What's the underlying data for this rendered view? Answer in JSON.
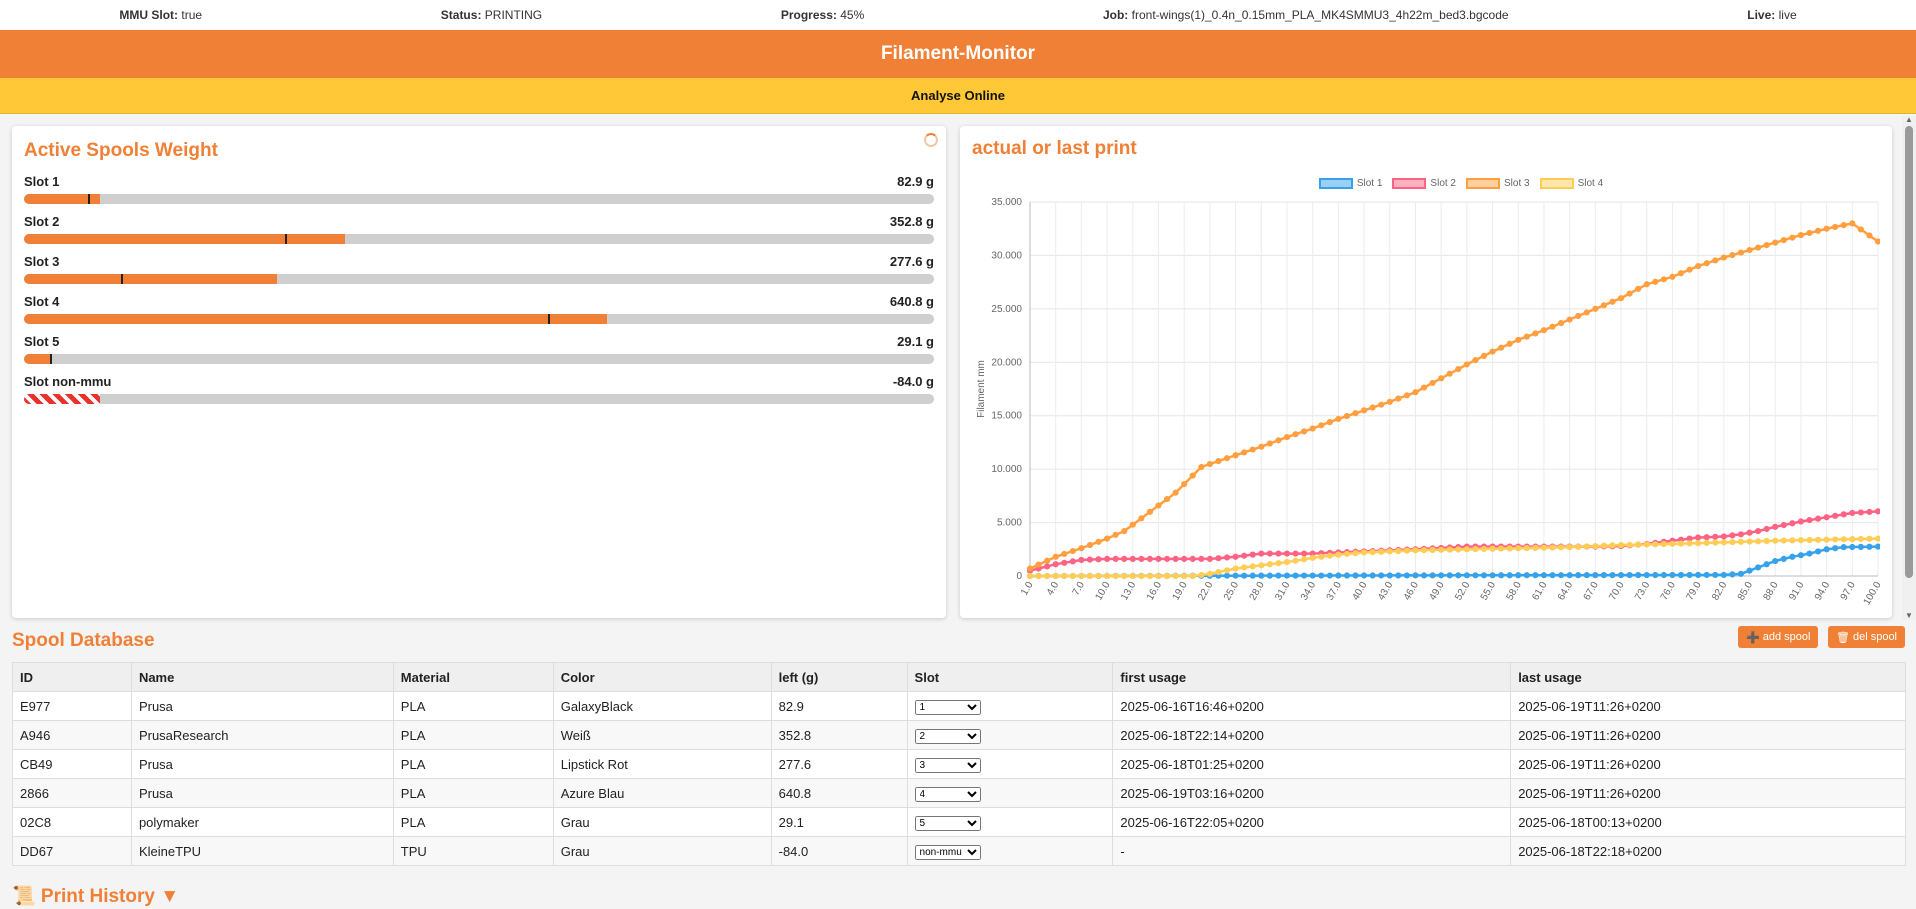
{
  "status": {
    "mmu_label": "MMU Slot:",
    "mmu_value": "true",
    "status_label": "Status:",
    "status_value": "PRINTING",
    "progress_label": "Progress:",
    "progress_value": "45%",
    "job_label": "Job:",
    "job_value": "front-wings(1)_0.4n_0.15mm_PLA_MK4SMMU3_4h22m_bed3.bgcode",
    "live_label": "Live:",
    "live_value": "live"
  },
  "header": {
    "title": "Filament-Monitor",
    "subtitle": "Analyse Online"
  },
  "spools_panel": {
    "title": "Active Spools Weight",
    "slots": [
      {
        "label": "Slot 1",
        "weight": "82.9 g",
        "fill": 0.083,
        "marker": 0.07
      },
      {
        "label": "Slot 2",
        "weight": "352.8 g",
        "fill": 0.353,
        "marker": 0.287
      },
      {
        "label": "Slot 3",
        "weight": "277.6 g",
        "fill": 0.278,
        "marker": 0.107
      },
      {
        "label": "Slot 4",
        "weight": "640.8 g",
        "fill": 0.641,
        "marker": 0.576
      },
      {
        "label": "Slot 5",
        "weight": "29.1 g",
        "fill": 0.029,
        "marker": 0.029
      },
      {
        "label": "Slot non-mmu",
        "weight": "-84.0 g",
        "fill": 0.084,
        "negative": true
      }
    ]
  },
  "chart_panel": {
    "title": "actual or last print",
    "chart_data": {
      "type": "line",
      "ylabel": "Filament mm",
      "ylim": [
        0,
        35000
      ],
      "yticks": [
        "0",
        "5.000",
        "10.000",
        "15.000",
        "20.000",
        "25.000",
        "30.000",
        "35.000"
      ],
      "x_start": 1.0,
      "x_end": 100.0,
      "x_step": 1.0,
      "x_tick_labels": [
        "1.0",
        "4.0",
        "7.0",
        "10.0",
        "13.0",
        "16.0",
        "19.0",
        "22.0",
        "25.0",
        "28.0",
        "31.0",
        "34.0",
        "37.0",
        "40.0",
        "43.0",
        "46.0",
        "49.0",
        "52.0",
        "55.0",
        "58.0",
        "61.0",
        "64.0",
        "67.0",
        "70.0",
        "73.0",
        "76.0",
        "79.0",
        "82.0",
        "85.0",
        "88.0",
        "91.0",
        "94.0",
        "97.0",
        "100.0"
      ],
      "grid": true,
      "legend_position": "top",
      "series": [
        {
          "name": "Slot 1",
          "color": "#36a2eb",
          "fill": "#9ad0f5",
          "points": [
            [
              1,
              0
            ],
            [
              82,
              100
            ],
            [
              84,
              200
            ],
            [
              86,
              800
            ],
            [
              88,
              1400
            ],
            [
              90,
              1800
            ],
            [
              92,
              2100
            ],
            [
              94,
              2500
            ],
            [
              96,
              2700
            ],
            [
              100,
              2750
            ]
          ]
        },
        {
          "name": "Slot 2",
          "color": "#ff6384",
          "fill": "#ffb1c1",
          "points": [
            [
              1,
              500
            ],
            [
              4,
              1100
            ],
            [
              7,
              1500
            ],
            [
              10,
              1600
            ],
            [
              19,
              1600
            ],
            [
              22,
              1600
            ],
            [
              25,
              1800
            ],
            [
              28,
              2100
            ],
            [
              34,
              2100
            ],
            [
              40,
              2300
            ],
            [
              46,
              2500
            ],
            [
              52,
              2750
            ],
            [
              67,
              2750
            ],
            [
              70,
              2800
            ],
            [
              73,
              3000
            ],
            [
              76,
              3300
            ],
            [
              79,
              3600
            ],
            [
              82,
              3700
            ],
            [
              84,
              3900
            ],
            [
              86,
              4200
            ],
            [
              88,
              4600
            ],
            [
              91,
              5100
            ],
            [
              94,
              5500
            ],
            [
              97,
              5900
            ],
            [
              100,
              6050
            ]
          ]
        },
        {
          "name": "Slot 3",
          "color": "#ff9f40",
          "fill": "#ffcf9f",
          "points": [
            [
              1,
              700
            ],
            [
              4,
              1800
            ],
            [
              7,
              2600
            ],
            [
              10,
              3500
            ],
            [
              12,
              4200
            ],
            [
              15,
              6000
            ],
            [
              18,
              7800
            ],
            [
              21,
              10200
            ],
            [
              25,
              11300
            ],
            [
              28,
              12100
            ],
            [
              31,
              13000
            ],
            [
              34,
              13800
            ],
            [
              37,
              14700
            ],
            [
              40,
              15500
            ],
            [
              43,
              16300
            ],
            [
              46,
              17200
            ],
            [
              49,
              18500
            ],
            [
              52,
              19800
            ],
            [
              55,
              21000
            ],
            [
              58,
              22100
            ],
            [
              61,
              23000
            ],
            [
              64,
              24000
            ],
            [
              67,
              25000
            ],
            [
              70,
              26000
            ],
            [
              73,
              27300
            ],
            [
              76,
              28000
            ],
            [
              79,
              29000
            ],
            [
              82,
              29800
            ],
            [
              85,
              30500
            ],
            [
              88,
              31200
            ],
            [
              91,
              31900
            ],
            [
              94,
              32500
            ],
            [
              97,
              33000
            ],
            [
              100,
              31300
            ]
          ]
        },
        {
          "name": "Slot 4",
          "color": "#ffcd56",
          "fill": "#ffe6aa",
          "points": [
            [
              1,
              0
            ],
            [
              20,
              0
            ],
            [
              22,
              200
            ],
            [
              25,
              700
            ],
            [
              28,
              1000
            ],
            [
              31,
              1300
            ],
            [
              34,
              1700
            ],
            [
              37,
              2000
            ],
            [
              40,
              2200
            ],
            [
              46,
              2400
            ],
            [
              52,
              2500
            ],
            [
              58,
              2600
            ],
            [
              64,
              2700
            ],
            [
              70,
              2900
            ],
            [
              76,
              3000
            ],
            [
              82,
              3150
            ],
            [
              88,
              3300
            ],
            [
              94,
              3400
            ],
            [
              100,
              3500
            ]
          ]
        }
      ]
    }
  },
  "db": {
    "title": "Spool Database",
    "add_label": "add spool",
    "del_label": "del spool",
    "columns": [
      "ID",
      "Name",
      "Material",
      "Color",
      "left (g)",
      "Slot",
      "first usage",
      "last usage"
    ],
    "rows": [
      {
        "id": "E977",
        "name": "Prusa",
        "material": "PLA",
        "color": "GalaxyBlack",
        "left": "82.9",
        "slot": "1",
        "first": "2025-06-16T16:46+0200",
        "last": "2025-06-19T11:26+0200"
      },
      {
        "id": "A946",
        "name": "PrusaResearch",
        "material": "PLA",
        "color": "Weiß",
        "left": "352.8",
        "slot": "2",
        "first": "2025-06-18T22:14+0200",
        "last": "2025-06-19T11:26+0200"
      },
      {
        "id": "CB49",
        "name": "Prusa",
        "material": "PLA",
        "color": "Lipstick Rot",
        "left": "277.6",
        "slot": "3",
        "first": "2025-06-18T01:25+0200",
        "last": "2025-06-19T11:26+0200"
      },
      {
        "id": "2866",
        "name": "Prusa",
        "material": "PLA",
        "color": "Azure Blau",
        "left": "640.8",
        "slot": "4",
        "first": "2025-06-19T03:16+0200",
        "last": "2025-06-19T11:26+0200"
      },
      {
        "id": "02C8",
        "name": "polymaker",
        "material": "PLA",
        "color": "Grau",
        "left": "29.1",
        "slot": "5",
        "first": "2025-06-16T22:05+0200",
        "last": "2025-06-18T00:13+0200"
      },
      {
        "id": "DD67",
        "name": "KleineTPU",
        "material": "TPU",
        "color": "Grau",
        "left": "-84.0",
        "slot": "non-mmu",
        "first": "-",
        "last": "2025-06-18T22:18+0200"
      }
    ]
  },
  "history": {
    "title": "📜 Print History ▼"
  }
}
